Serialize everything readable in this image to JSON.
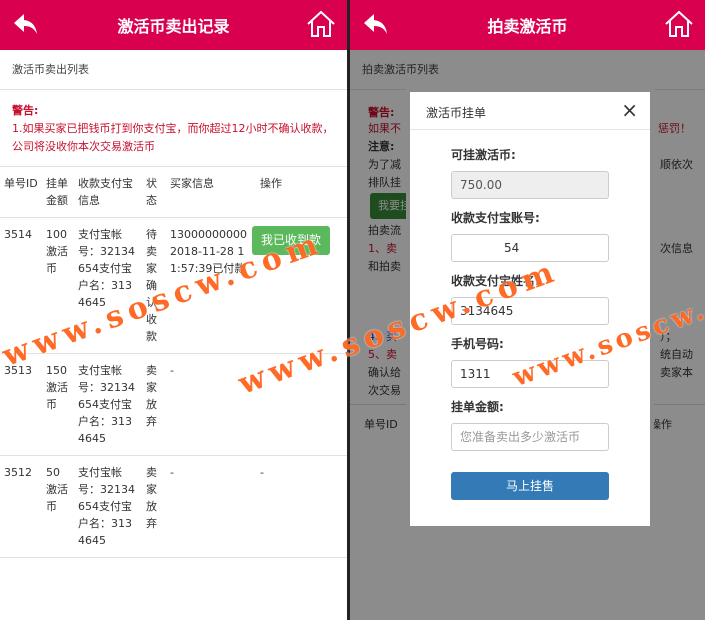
{
  "left": {
    "title": "激活币卖出记录",
    "subhead": "激活币卖出列表",
    "warning_title": "警告:",
    "warning_text": "1.如果买家已把钱币打到你支付宝，而你超过12小时不确认收款，公司将没收你本次交易激活币",
    "columns": [
      "单号ID",
      "挂单金额",
      "收款支付宝信息",
      "状态",
      "买家信息",
      "操作"
    ],
    "rows": [
      {
        "id": "3514",
        "amount": "100激活币",
        "alipay": "支付宝帐号：32134654支付宝户名：3134645",
        "status": "待卖家确认收款",
        "buyer": "130000000002018-11-28 11:57:39已付款",
        "action": "我已收到款"
      },
      {
        "id": "3513",
        "amount": "150激活币",
        "alipay": "支付宝帐号：32134654支付宝户名：3134645",
        "status": "卖家放弃",
        "buyer": "-",
        "action": "-"
      },
      {
        "id": "3512",
        "amount": "50激活币",
        "alipay": "支付宝帐号：32134654支付宝户名：3134645",
        "status": "卖家放弃",
        "buyer": "-",
        "action": "-"
      }
    ]
  },
  "right": {
    "title": "拍卖激活币",
    "subhead": "拍卖激活币列表",
    "bg": {
      "warn": "警告:",
      "warn_line": "如果不",
      "warn_tail": "惩罚！",
      "note": "注意:",
      "note_line1": "为了减",
      "note_line1_tail": "顺依次",
      "note_line2": "排队挂",
      "btn": "我要挂",
      "flow": "拍卖流",
      "s1": "1、卖",
      "s1_tail": "次信息",
      "s1b": "和拍卖",
      "s4": "4、买",
      "s4_tail": "）；",
      "s5": "5、卖",
      "s5_tail": "统自动",
      "s5b": "确认给",
      "s5b_tail": "卖家本",
      "s5c": "次交易",
      "col_id": "单号ID",
      "col_op": "操作"
    },
    "modal": {
      "title": "激活币挂单",
      "close": "×",
      "fields": [
        {
          "label": "可挂激活币:",
          "value": "750.00"
        },
        {
          "label": "收款支付宝账号:",
          "value": "54"
        },
        {
          "label": "收款支付宝姓名:",
          "value": "3134645"
        },
        {
          "label": "手机号码:",
          "value": "1311"
        },
        {
          "label": "挂单金额:",
          "placeholder": "您准备卖出多少激活币"
        }
      ],
      "submit": "马上挂售"
    }
  },
  "watermark": "www.soscw.com",
  "colors": {
    "header": "#d8004f",
    "warning": "#c8102e",
    "green": "#5cb85c",
    "blue": "#337ab7"
  }
}
